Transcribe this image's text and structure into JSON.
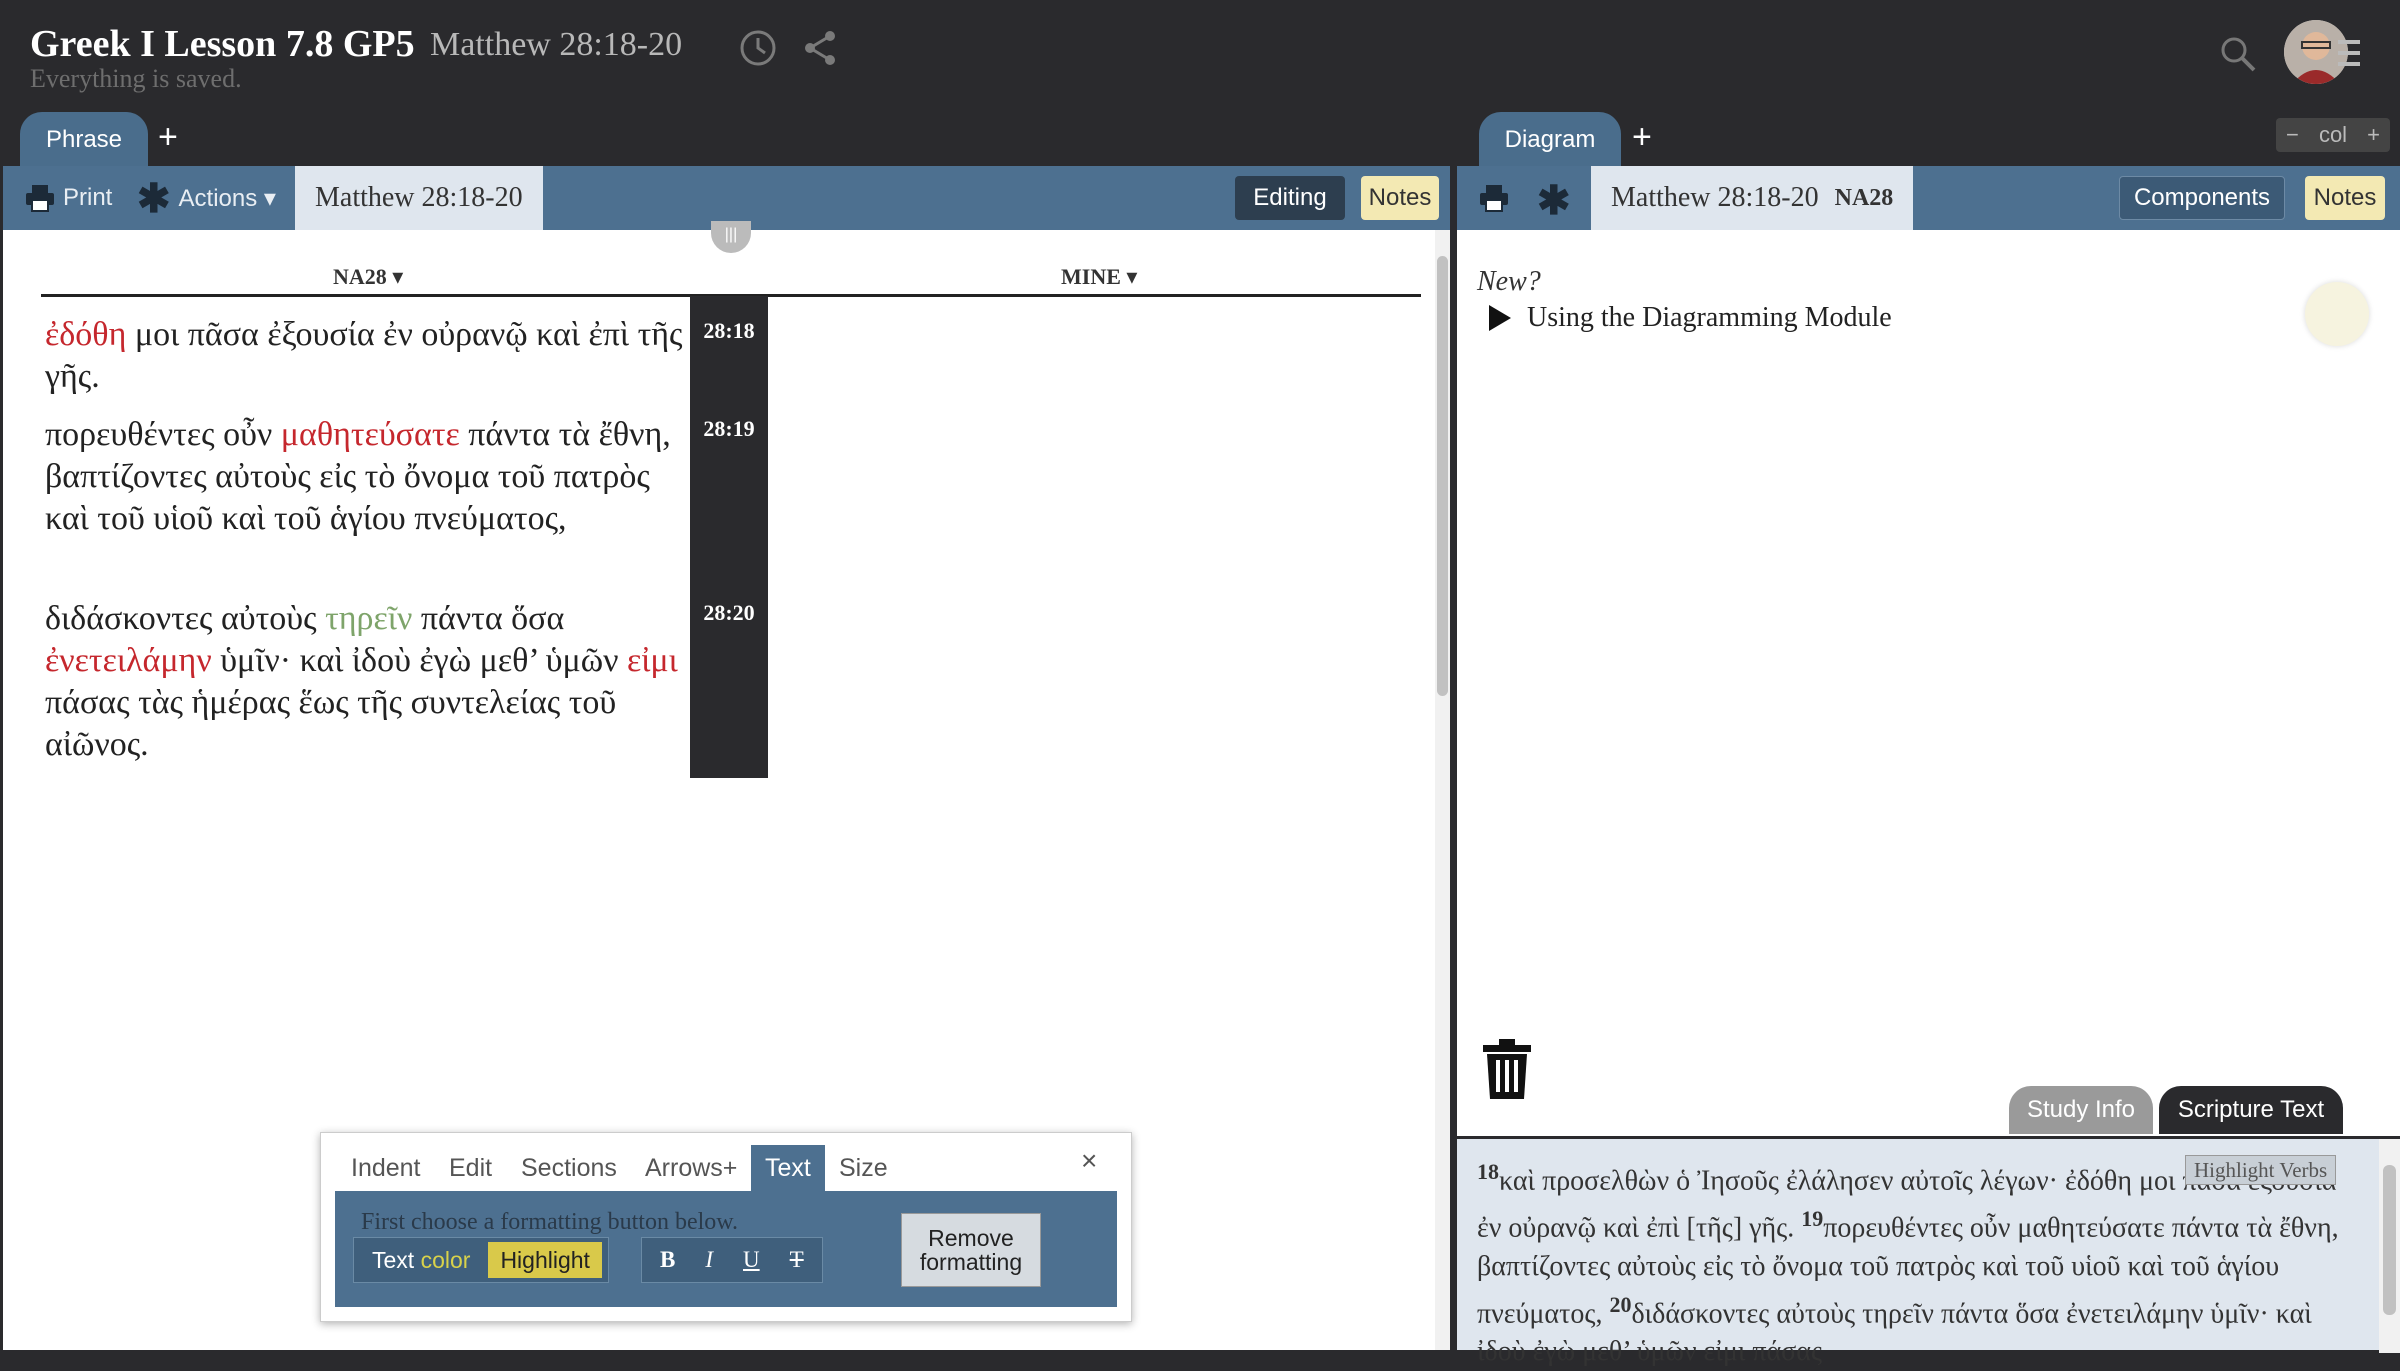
{
  "header": {
    "title": "Greek I Lesson 7.8 GP5",
    "subtitle": "Matthew 28:18-20",
    "save_status": "Everything is saved."
  },
  "left_tabs": {
    "phrase": "Phrase",
    "add": "+"
  },
  "right_tabs": {
    "diagram": "Diagram",
    "add": "+"
  },
  "col_control": {
    "minus": "−",
    "label": "col",
    "plus": "+"
  },
  "left_toolbar": {
    "print": "Print",
    "actions": "Actions ▾",
    "reference": "Matthew 28:18-20",
    "editing": "Editing",
    "notes": "Notes"
  },
  "columns": {
    "left": "NA28 ▾",
    "right": "MINE ▾"
  },
  "verses": [
    {
      "num": "28:18"
    },
    {
      "num": "28:19"
    },
    {
      "num": "28:20"
    }
  ],
  "verse_text": {
    "v18_a": "ἐδόθη",
    "v18_b": " μοι πᾶσα ἐξουσία ἐν οὐρανῷ καὶ ἐπὶ τῆς γῆς.",
    "v19_a": "πορευθέντες οὖν ",
    "v19_b": "μαθητεύσατε",
    "v19_c": " πάντα τὰ ἔθνη, βαπτίζοντες αὐτοὺς εἰς τὸ ὄνομα τοῦ πατρὸς καὶ τοῦ υἱοῦ καὶ τοῦ ἁγίου πνεύματος,",
    "v20_a": "διδάσκοντες αὐτοὺς ",
    "v20_b": "τηρεῖν",
    "v20_c": " πάντα ὅσα ",
    "v20_d": "ἐνετειλάμην",
    "v20_e": " ὑμῖν· καὶ ἰδοὺ ἐγὼ μεθ’ ὑμῶν ",
    "v20_f": "εἰμι",
    "v20_g": " πάσας τὰς ἡμέρας ἕως τῆς συντελείας τοῦ αἰῶνος."
  },
  "format_panel": {
    "tabs": [
      "Indent",
      "Edit",
      "Sections",
      "Arrows+",
      "Text",
      "Size"
    ],
    "close": "×",
    "hint": "First choose a formatting button below.",
    "text_label": "Text",
    "color_label": "color",
    "highlight": "Highlight",
    "bold": "B",
    "italic": "I",
    "underline": "U",
    "strike": "T",
    "remove_line1": "Remove",
    "remove_line2": "formatting"
  },
  "right_toolbar": {
    "reference": "Matthew 28:18-20",
    "edition": "NA28",
    "components": "Components",
    "notes": "Notes"
  },
  "diagram": {
    "new_label": "New?",
    "link": "Using the Diagramming Module"
  },
  "side_tabs": {
    "study": "Study Info",
    "scripture": "Scripture Text"
  },
  "scripture": {
    "n18": "18",
    "t18": "καὶ προσελθὼν ὁ Ἰησοῦς ἐλάλησεν αὐτοῖς λέγων· ἐδόθη μοι πᾶσα ἐξουσία ἐν οὐρανῷ καὶ ἐπὶ [τῆς] γῆς. ",
    "n19": "19",
    "t19": "πορευθέντες οὖν μαθητεύσατε πάντα τὰ ἔθνη, βαπτίζοντες αὐτοὺς εἰς τὸ ὄνομα τοῦ πατρὸς καὶ τοῦ υἱοῦ καὶ τοῦ ἁγίου πνεύματος, ",
    "n20": "20",
    "t20": "διδάσκοντες αὐτοὺς τηρεῖν πάντα ὅσα ἐνετειλάμην ὑμῖν· καὶ ἰδοὺ ἐγὼ μεθ’ ὑμῶν εἰμι πάσας",
    "highlight_verbs": "Highlight Verbs"
  },
  "colors": {
    "toolbar": "#4d7090",
    "verb_red": "#c5272d",
    "verb_green": "#7ea46a",
    "notes_bg": "#f3e9b3"
  }
}
